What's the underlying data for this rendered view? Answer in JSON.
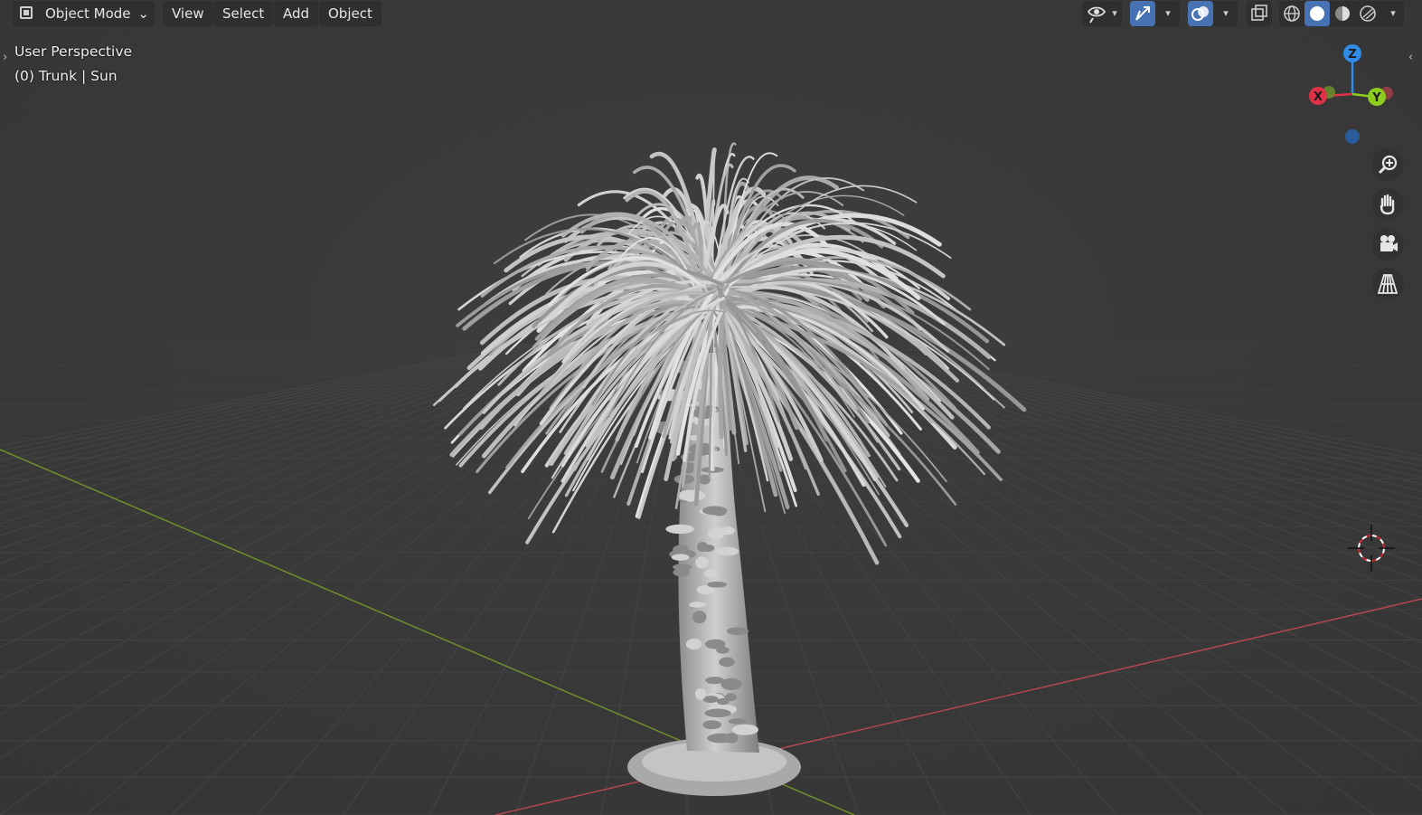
{
  "header": {
    "mode_label": "Object Mode",
    "menus": [
      "View",
      "Select",
      "Add",
      "Object"
    ]
  },
  "overlay": {
    "perspective_label": "User Perspective",
    "object_info": "(0) Trunk | Sun"
  },
  "gizmo": {
    "z_label": "Z",
    "x_label": "X",
    "y_label": "Y"
  },
  "icons": {
    "visibility": "eye-icon",
    "gizmo_toggle": "gizmo-icon",
    "overlays": "overlays-icon",
    "xray": "xray-icon",
    "wireframe": "wireframe-shading-icon",
    "solid": "solid-shading-icon",
    "material": "material-preview-icon",
    "rendered": "rendered-shading-icon",
    "zoom": "zoom-icon",
    "pan": "hand-icon",
    "camera": "camera-icon",
    "ortho": "perspective-grid-icon"
  },
  "colors": {
    "background": "#393939",
    "grid": "#404040",
    "x_axis": "#b5474f",
    "y_axis": "#6f8f2a",
    "z_axis": "#2f8ae8",
    "active_button": "#4772b3",
    "tree": "#b9b9b9"
  }
}
